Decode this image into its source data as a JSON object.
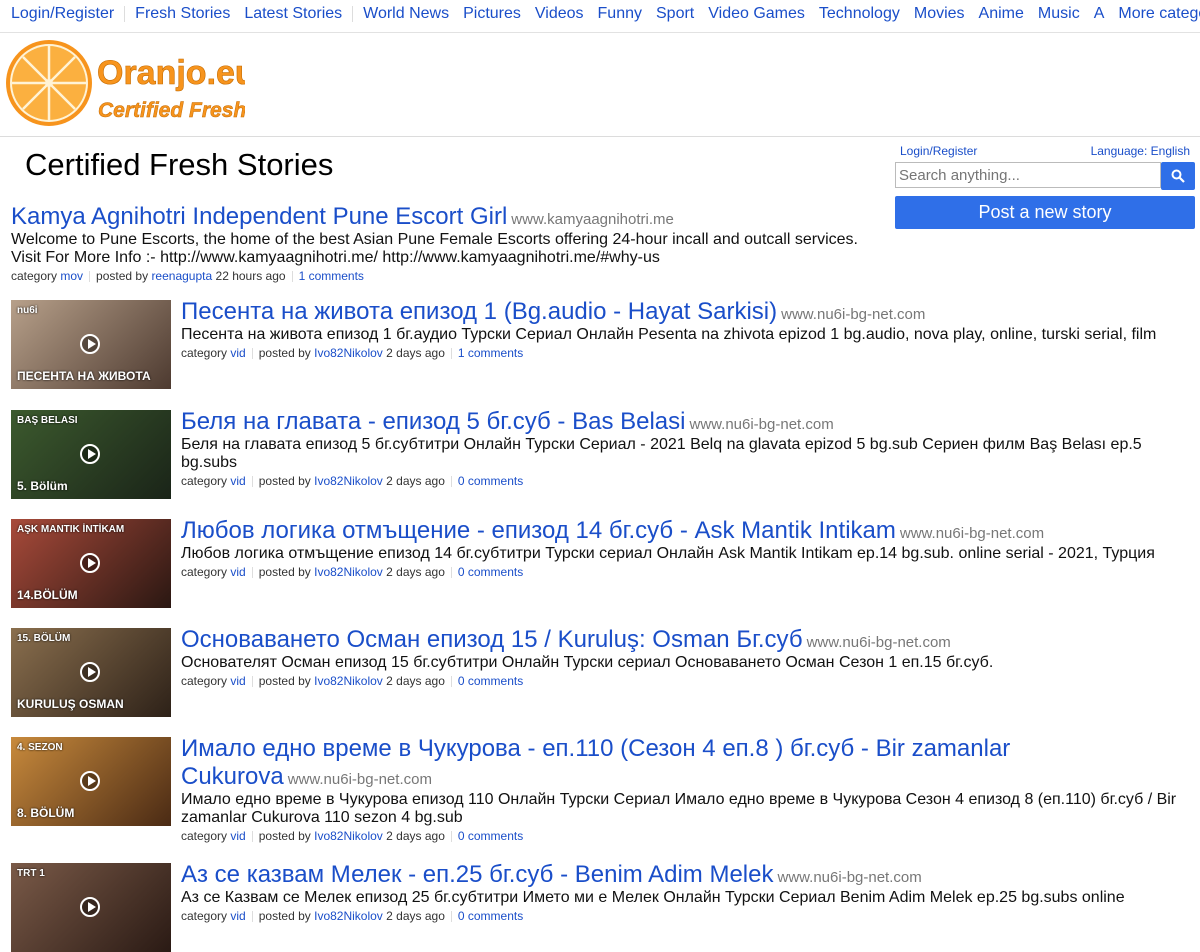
{
  "nav": {
    "items": [
      "Login/Register",
      "Fresh Stories",
      "Latest Stories",
      "World News",
      "Pictures",
      "Videos",
      "Funny",
      "Sport",
      "Video Games",
      "Technology",
      "Movies",
      "Anime",
      "Music",
      "A",
      "More categories"
    ]
  },
  "logo": {
    "name": "Oranjo.eu",
    "tagline": "Certified Fresh"
  },
  "page": {
    "title": "Certified Fresh Stories"
  },
  "sidebar": {
    "login": "Login/Register",
    "language": "Language: English",
    "search_placeholder": "Search anything...",
    "post_label": "Post a new story"
  },
  "stories": [
    {
      "title": "Kamya Agnihotri Independent Pune Escort Girl",
      "domain": "www.kamyaagnihotri.me",
      "desc": "Welcome to Pune Escorts, the home of the best Asian Pune Female Escorts offering 24-hour incall and outcall services. Visit For More Info :- http://www.kamyaagnihotri.me/ http://www.kamyaagnihotri.me/#why-us",
      "category_label": "category",
      "category": "mov",
      "posted_label": "posted by",
      "user": "reenagupta",
      "time": "22 hours ago",
      "comments": "1 comments"
    },
    {
      "title": "Песента на живота епизод 1 (Bg.audio - Hayat Sarkisi)",
      "domain": "www.nu6i-bg-net.com",
      "desc": "Песента на живота епизод 1 бг.аудио Турски Сериал Онлайн Pesenta na zhivota epizod 1 bg.audio, nova play, online, turski serial, film",
      "category_label": "category",
      "category": "vid",
      "posted_label": "posted by",
      "user": "Ivo82Nikolov",
      "time": "2 days ago",
      "comments": "1 comments",
      "thumb": {
        "caption": "ПЕСЕНТА НА ЖИВОТА",
        "badge": "nu6i",
        "bg": [
          "#b7a08a",
          "#4d3a30"
        ]
      }
    },
    {
      "title": "Беля на главата - епизод 5 бг.суб - Bas Belasi",
      "domain": "www.nu6i-bg-net.com",
      "desc": "Беля на главата епизод 5 бг.субтитри Онлайн Турски Сериал - 2021 Belq na glavata epizod 5 bg.sub Сериен филм Baş Belası ep.5 bg.subs",
      "category_label": "category",
      "category": "vid",
      "posted_label": "posted by",
      "user": "Ivo82Nikolov",
      "time": "2 days ago",
      "comments": "0 comments",
      "thumb": {
        "caption": "5. Bölüm",
        "badge": "BAŞ BELASI",
        "bg": [
          "#3c5a2e",
          "#1a2418"
        ]
      }
    },
    {
      "title": "Любов логика отмъщение - епизод 14 бг.суб - Ask Mantik Intikam",
      "domain": "www.nu6i-bg-net.com",
      "desc": "Любов логика отмъщение епизод 14 бг.субтитри Турски сериал Онлайн Ask Mantik Intikam ep.14 bg.sub. online serial - 2021, Турция",
      "category_label": "category",
      "category": "vid",
      "posted_label": "posted by",
      "user": "Ivo82Nikolov",
      "time": "2 days ago",
      "comments": "0 comments",
      "thumb": {
        "caption": "14.BÖLÜM",
        "badge": "AŞK MANTIK İNTİKAM",
        "bg": [
          "#a84a3a",
          "#2a1712"
        ]
      }
    },
    {
      "title": "Основаването Осман епизод 15 / Kuruluş: Osman Бг.суб",
      "domain": "www.nu6i-bg-net.com",
      "desc": "Основателят Осман епизод 15 бг.субтитри Онлайн Турски сериал Основаването Осман Сезон 1 еп.15 бг.суб.",
      "category_label": "category",
      "category": "vid",
      "posted_label": "posted by",
      "user": "Ivo82Nikolov",
      "time": "2 days ago",
      "comments": "0 comments",
      "thumb": {
        "caption": "KURULUŞ OSMAN",
        "badge": "15. BÖLÜM",
        "bg": [
          "#8a6f4e",
          "#2d2118"
        ]
      }
    },
    {
      "title": "Имало едно време в Чукурова - еп.110 (Сезон 4 еп.8 ) бг.суб - Bir zamanlar Cukurova",
      "domain": "www.nu6i-bg-net.com",
      "desc": "Имало едно време в Чукурова епизод 110 Онлайн Турски Сериал Имало едно време в Чукурова Сезон 4 епизод 8 (еп.110) бг.суб / Bir zamanlar Cukurova 110 sezon 4 bg.sub",
      "category_label": "category",
      "category": "vid",
      "posted_label": "posted by",
      "user": "Ivo82Nikolov",
      "time": "2 days ago",
      "comments": "0 comments",
      "thumb": {
        "caption": "8. BÖLÜM",
        "badge": "4. SEZON",
        "bg": [
          "#c88a3c",
          "#4a2a14"
        ]
      }
    },
    {
      "title": "Аз се казвам Мелек - еп.25 бг.суб - Benim Adim Melek",
      "domain": "www.nu6i-bg-net.com",
      "desc": "Аз се Казвам се Мелек епизод 25 бг.субтитри Името ми е Мелек Онлайн Турски Сериал Benim Adim Melek ep.25 bg.subs online",
      "category_label": "category",
      "category": "vid",
      "posted_label": "posted by",
      "user": "Ivo82Nikolov",
      "time": "2 days ago",
      "comments": "0 comments",
      "thumb": {
        "caption": "",
        "badge": "TRT 1",
        "bg": [
          "#7a5a48",
          "#2a1a14"
        ]
      }
    }
  ]
}
